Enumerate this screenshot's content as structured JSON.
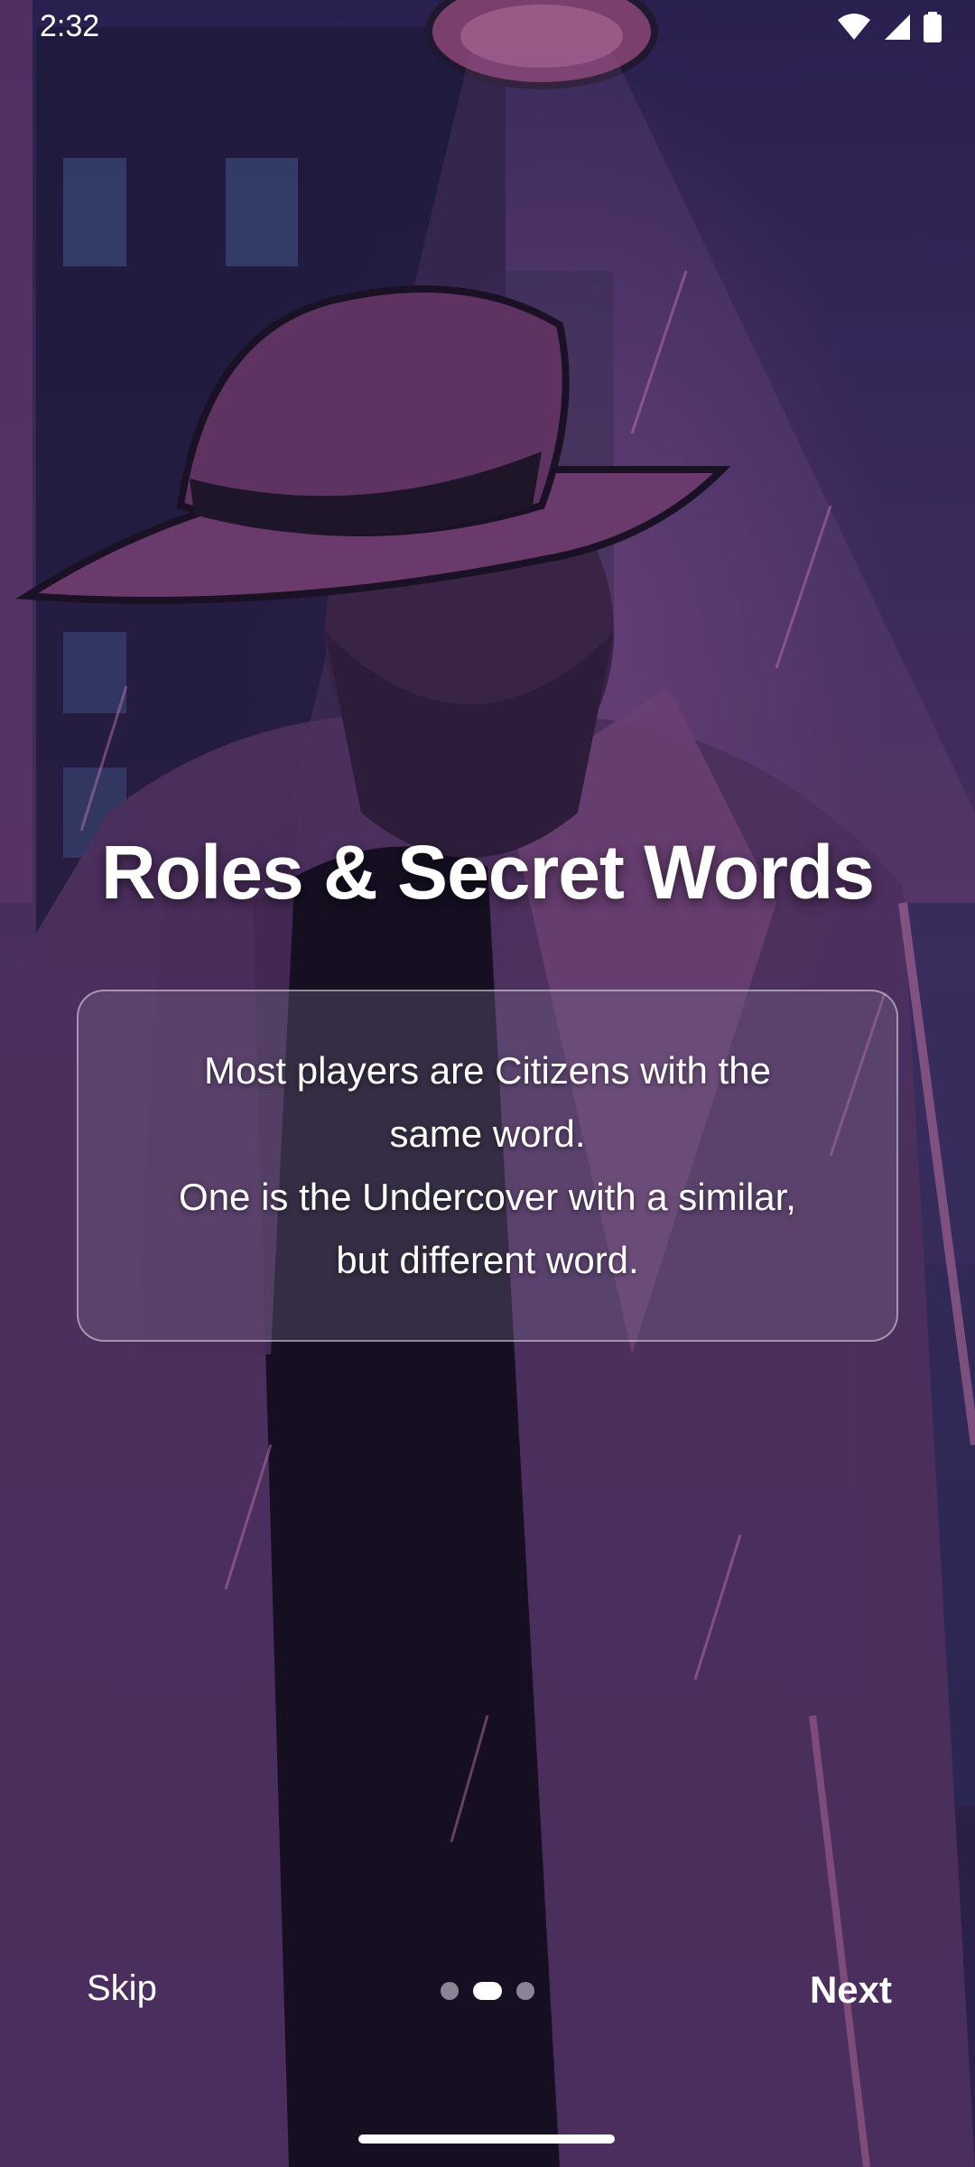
{
  "status_bar": {
    "time": "2:32",
    "icons": [
      "wifi-icon",
      "signal-icon",
      "battery-icon"
    ]
  },
  "onboarding": {
    "title": "Roles & Secret Words",
    "description_lines": [
      "Most players are Citizens with the",
      "same word.",
      "One is the Undercover with a similar,",
      "but different word."
    ],
    "skip_label": "Skip",
    "next_label": "Next",
    "page_indicator": {
      "total_pages": 3,
      "current_page": 2
    }
  },
  "colors": {
    "background_dark": "#2a2050",
    "background_mid": "#4a2f5e",
    "accent_pink": "#b06a9a",
    "text": "#ffffff",
    "dot_inactive": "#8a8494"
  }
}
